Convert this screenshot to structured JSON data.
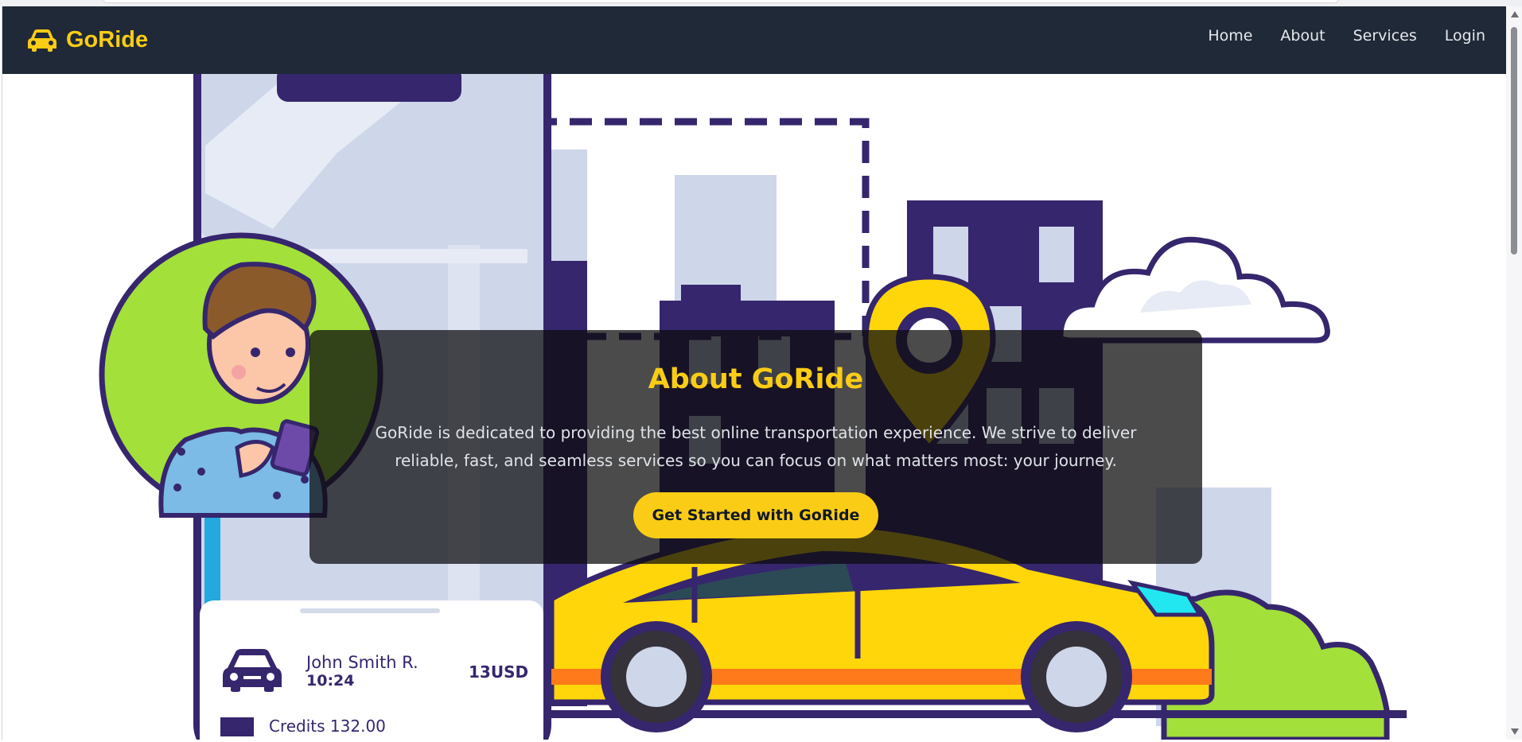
{
  "brand": {
    "name": "GoRide",
    "icon": "car-icon",
    "color": "#facc15"
  },
  "nav": {
    "items": [
      "Home",
      "About",
      "Services",
      "Login"
    ]
  },
  "about": {
    "title": "About GoRide",
    "description": "GoRide is dedicated to providing the best online transportation experience. We strive to deliver reliable, fast, and seamless services so you can focus on what matters most: your journey.",
    "cta_label": "Get Started with GoRide"
  },
  "illustration": {
    "ride_card": {
      "driver_name": "John Smith R.",
      "time": "10:24",
      "price": "13USD",
      "credits": "Credits 132.00"
    }
  },
  "colors": {
    "navbar": "#1f2937",
    "accent": "#facc15",
    "illustration_purple": "#36266d",
    "illustration_light": "#ced6ea",
    "illustration_green": "#a3e03a",
    "taxi_yellow": "#ffd60a"
  }
}
